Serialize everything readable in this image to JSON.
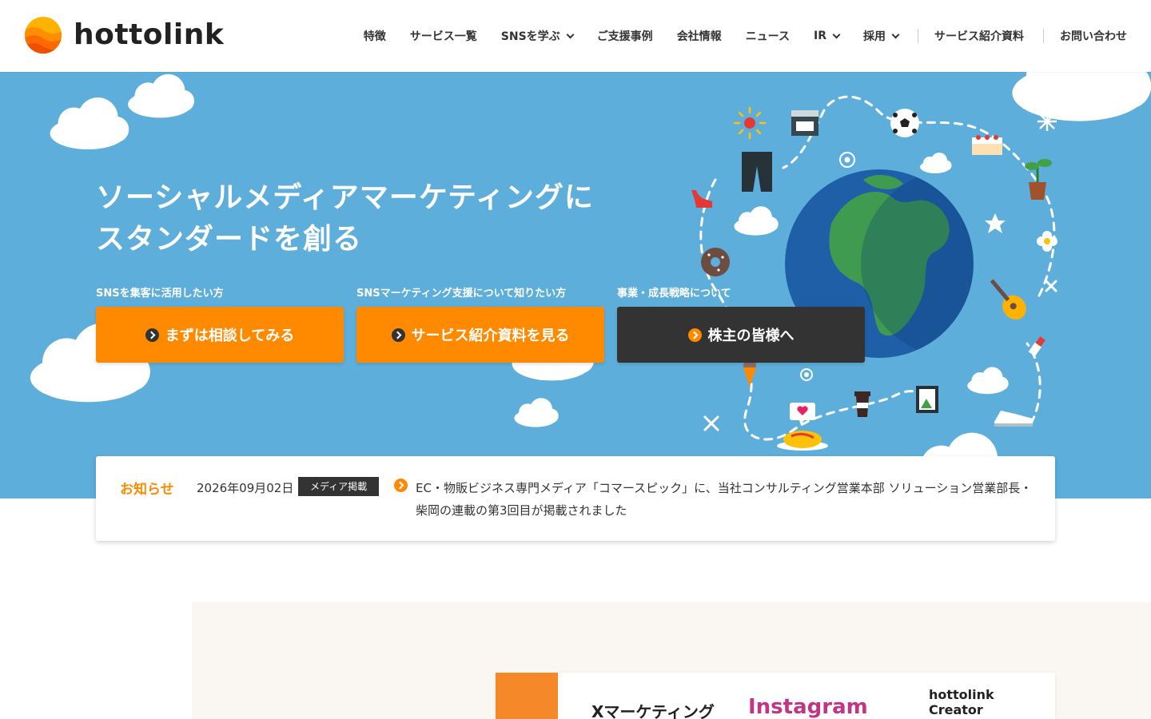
{
  "brand": {
    "name": "hottolink",
    "logo_icon": "sun-logo-icon"
  },
  "nav": {
    "items": [
      {
        "label": "特徴",
        "dropdown": false
      },
      {
        "label": "サービス一覧",
        "dropdown": false
      },
      {
        "label": "SNSを学ぶ",
        "dropdown": true
      },
      {
        "label": "ご支援事例",
        "dropdown": false
      },
      {
        "label": "会社情報",
        "dropdown": false
      },
      {
        "label": "ニュース",
        "dropdown": false
      },
      {
        "label": "IR",
        "dropdown": true
      },
      {
        "label": "採用",
        "dropdown": true
      }
    ],
    "doc_link": "サービス紹介資料",
    "contact_link": "お問い合わせ"
  },
  "hero": {
    "title_line1": "ソーシャルメディアマーケティングに",
    "title_line2": "スタンダードを創る",
    "ctas": [
      {
        "caption": "SNSを集客に活用したい方",
        "label": "まずは相談してみる",
        "style": "orange"
      },
      {
        "caption": "SNSマーケティング支援について知りたい方",
        "label": "サービス紹介資料を見る",
        "style": "orange"
      },
      {
        "caption": "事業・成長戦略について",
        "label": "株主の皆様へ",
        "style": "dark"
      }
    ]
  },
  "news": {
    "heading": "お知らせ",
    "date": "2026年09月02日",
    "category": "メディア掲載",
    "text": "EC・物販ビジネス専門メディア「コマースピック」に、当社コンサルティング営業本部 ソリューション営業部長・柴岡の連載の第3回目が掲載されました"
  },
  "services": {
    "x_label": "Xマーケティング",
    "instagram_label": "Instagram",
    "creator_line1": "hottolink",
    "creator_line2": "Creator"
  },
  "colors": {
    "accent": "#ff8a00",
    "hero_bg": "#5eaedb",
    "dark": "#333333",
    "globe_ocean": "#1f5fa8",
    "globe_land": "#3e9b4f"
  }
}
